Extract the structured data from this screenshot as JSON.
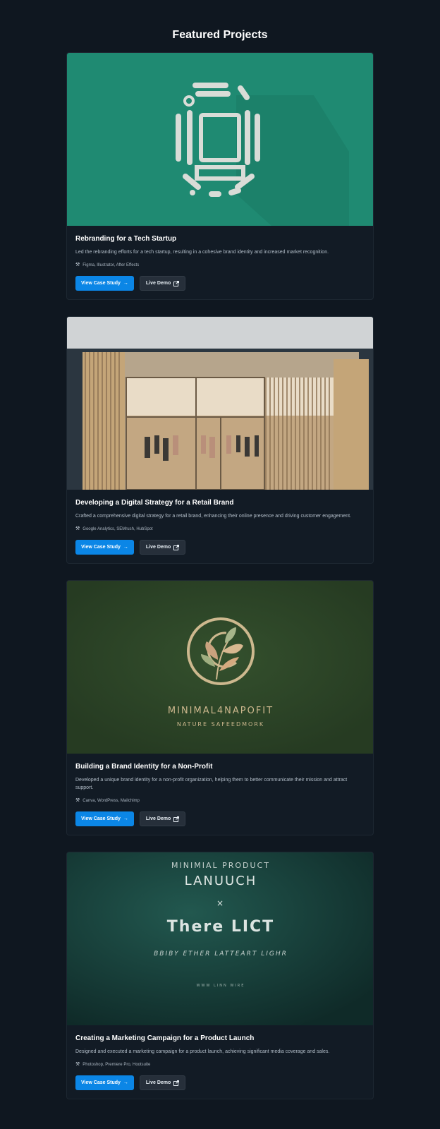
{
  "page": {
    "title": "Featured Projects"
  },
  "projects": [
    {
      "title": "Rebranding for a Tech Startup",
      "description": "Led the rebranding efforts for a tech startup, resulting in a cohesive brand identity and increased market recognition.",
      "tools": "Figma, Illustrator, After Effects",
      "case_study_label": "View Case Study",
      "demo_label": "Live Demo",
      "image_icon": "tech-device-logo"
    },
    {
      "title": "Developing a Digital Strategy for a Retail Brand",
      "description": "Crafted a comprehensive digital strategy for a retail brand, enhancing their online presence and driving customer engagement.",
      "tools": "Google Analytics, SEMrush, HubSpot",
      "case_study_label": "View Case Study",
      "demo_label": "Live Demo",
      "image_icon": "retail-storefront"
    },
    {
      "title": "Building a Brand Identity for a Non-Profit",
      "description": "Developed a unique brand identity for a non-profit organization, helping them to better communicate their mission and attract support.",
      "tools": "Canva, WordPress, Mailchimp",
      "case_study_label": "View Case Study",
      "demo_label": "Live Demo",
      "image_icon": "leaf-emblem",
      "image_text": {
        "line1": "MINIMAL4NAPOFIT",
        "line2": "NATURE SAFEEDMORK"
      }
    },
    {
      "title": "Creating a Marketing Campaign for a Product Launch",
      "description": "Designed and executed a marketing campaign for a product launch, achieving significant media coverage and sales.",
      "tools": "Photoshop, Premiere Pro, Hootsuite",
      "case_study_label": "View Case Study",
      "demo_label": "Live Demo",
      "image_icon": "launch-poster",
      "image_text": {
        "line1": "MINIMIAL PRODUCT",
        "line2": "LANUUCH",
        "line3": "×",
        "line4": "There LICT",
        "line5": "BBIBY ETHER LATTEART LIGHR",
        "line6": "WWW LINN WIRE"
      }
    }
  ],
  "colors": {
    "background": "#0f1720",
    "card": "#121b25",
    "primary": "#0b86e6",
    "secondary": "#262f3a",
    "hero1": "#1f8a72",
    "hero3": "#2d4427",
    "hero4": "#1a4a44"
  }
}
